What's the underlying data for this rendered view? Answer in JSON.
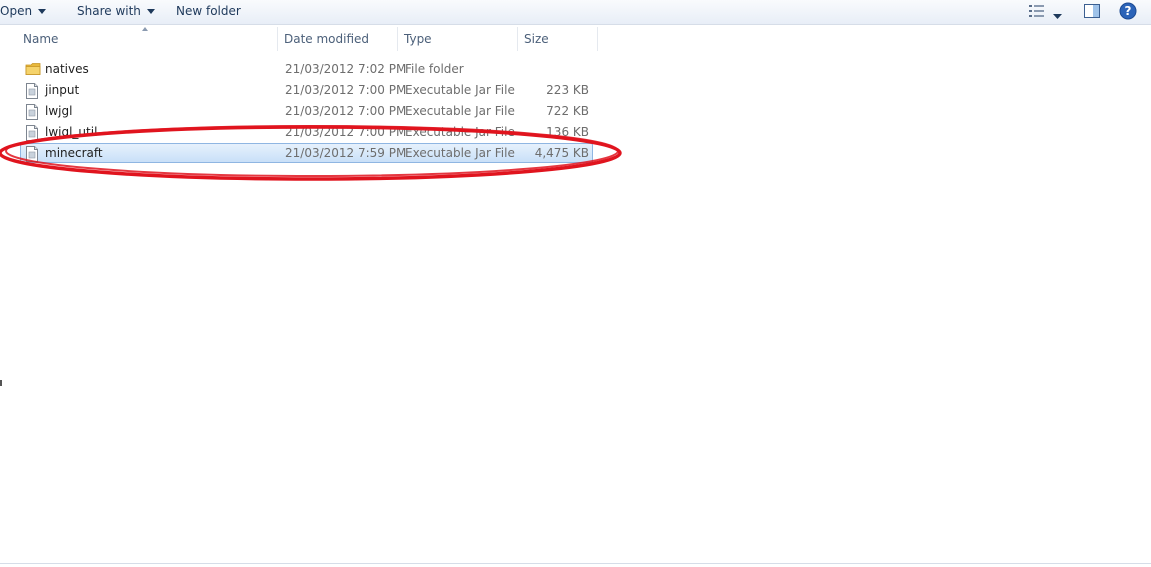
{
  "toolbar": {
    "open_label": "Open",
    "share_label": "Share with",
    "new_folder_label": "New folder",
    "icons": {
      "view": "details-view-icon",
      "view_menu": "chevron-down-icon",
      "preview": "preview-pane-icon",
      "help": "help-icon"
    }
  },
  "columns": {
    "name": "Name",
    "date": "Date modified",
    "type": "Type",
    "size": "Size"
  },
  "files": [
    {
      "name": "natives",
      "date": "21/03/2012 7:02 PM",
      "type": "File folder",
      "size": "",
      "icon": "folder-icon"
    },
    {
      "name": "jinput",
      "date": "21/03/2012 7:00 PM",
      "type": "Executable Jar File",
      "size": "223 KB",
      "icon": "jar-file-icon"
    },
    {
      "name": "lwjgl",
      "date": "21/03/2012 7:00 PM",
      "type": "Executable Jar File",
      "size": "722 KB",
      "icon": "jar-file-icon"
    },
    {
      "name": "lwjgl_util",
      "date": "21/03/2012 7:00 PM",
      "type": "Executable Jar File",
      "size": "136 KB",
      "icon": "jar-file-icon"
    },
    {
      "name": "minecraft",
      "date": "21/03/2012 7:59 PM",
      "type": "Executable Jar File",
      "size": "4,475 KB",
      "icon": "jar-file-icon",
      "selected": true
    }
  ],
  "annotation": {
    "color": "#e0141e",
    "shape": "ellipse"
  }
}
